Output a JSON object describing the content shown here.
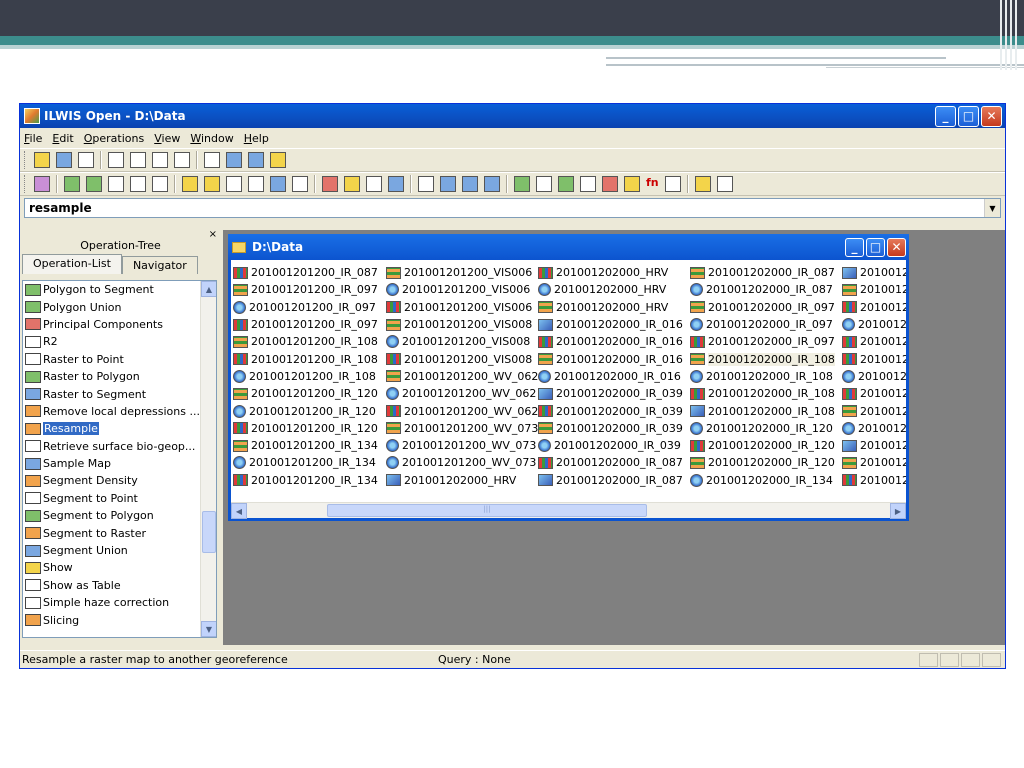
{
  "window": {
    "title": "ILWIS Open - D:\\Data"
  },
  "menu": [
    "File",
    "Edit",
    "Operations",
    "View",
    "Window",
    "Help"
  ],
  "command": {
    "value": "resample"
  },
  "left_pane": {
    "title": "Operation-Tree",
    "tabs": [
      "Operation-List",
      "Navigator"
    ],
    "close_glyph": "×",
    "items": [
      {
        "label": "Polygon to Segment",
        "icon": "polygon-map-icon"
      },
      {
        "label": "Polygon Union",
        "icon": "polygon-map-icon"
      },
      {
        "label": "Principal Components",
        "icon": "matrix-icon"
      },
      {
        "label": "R2",
        "icon": "table-icon"
      },
      {
        "label": "Raster to Point",
        "icon": "point-map-icon"
      },
      {
        "label": "Raster to Polygon",
        "icon": "polygon-map-icon"
      },
      {
        "label": "Raster to Segment",
        "icon": "segment-map-icon"
      },
      {
        "label": "Remove local depressions ...",
        "icon": "raster-map-icon"
      },
      {
        "label": "Resample",
        "icon": "raster-map-icon",
        "selected": true
      },
      {
        "label": "Retrieve surface bio-geop...",
        "icon": "point-map-icon"
      },
      {
        "label": "Sample Map",
        "icon": "sample-set-icon"
      },
      {
        "label": "Segment Density",
        "icon": "raster-map-icon"
      },
      {
        "label": "Segment to Point",
        "icon": "point-map-icon"
      },
      {
        "label": "Segment to Polygon",
        "icon": "polygon-map-icon"
      },
      {
        "label": "Segment to Raster",
        "icon": "raster-map-icon"
      },
      {
        "label": "Segment Union",
        "icon": "segment-map-icon"
      },
      {
        "label": "Show",
        "icon": "show-icon"
      },
      {
        "label": "Show as Table",
        "icon": "table-icon"
      },
      {
        "label": "Simple haze correction",
        "icon": "table-icon"
      },
      {
        "label": "Slicing",
        "icon": "raster-map-icon"
      }
    ]
  },
  "catalog": {
    "title": "D:\\Data",
    "columns": [
      [
        {
          "name": "201001201200_IR_087",
          "type": "raster"
        },
        {
          "name": "201001201200_IR_097",
          "type": "grid"
        },
        {
          "name": "201001201200_IR_097",
          "type": "csy"
        },
        {
          "name": "201001201200_IR_097",
          "type": "raster"
        },
        {
          "name": "201001201200_IR_108",
          "type": "grid"
        },
        {
          "name": "201001201200_IR_108",
          "type": "raster"
        },
        {
          "name": "201001201200_IR_108",
          "type": "csy"
        },
        {
          "name": "201001201200_IR_120",
          "type": "grid"
        },
        {
          "name": "201001201200_IR_120",
          "type": "csy"
        },
        {
          "name": "201001201200_IR_120",
          "type": "raster"
        },
        {
          "name": "201001201200_IR_134",
          "type": "grid"
        },
        {
          "name": "201001201200_IR_134",
          "type": "csy"
        },
        {
          "name": "201001201200_IR_134",
          "type": "raster"
        }
      ],
      [
        {
          "name": "201001201200_VIS006",
          "type": "grid"
        },
        {
          "name": "201001201200_VIS006",
          "type": "csy"
        },
        {
          "name": "201001201200_VIS006",
          "type": "raster"
        },
        {
          "name": "201001201200_VIS008",
          "type": "grid"
        },
        {
          "name": "201001201200_VIS008",
          "type": "csy"
        },
        {
          "name": "201001201200_VIS008",
          "type": "raster"
        },
        {
          "name": "201001201200_WV_062",
          "type": "grid"
        },
        {
          "name": "201001201200_WV_062",
          "type": "csy"
        },
        {
          "name": "201001201200_WV_062",
          "type": "raster"
        },
        {
          "name": "201001201200_WV_073",
          "type": "grid"
        },
        {
          "name": "201001201200_WV_073",
          "type": "csy"
        },
        {
          "name": "201001201200_WV_073",
          "type": "csy"
        },
        {
          "name": "201001202000_HRV",
          "type": "georef"
        }
      ],
      [
        {
          "name": "201001202000_HRV",
          "type": "raster"
        },
        {
          "name": "201001202000_HRV",
          "type": "csy"
        },
        {
          "name": "201001202000_HRV",
          "type": "grid"
        },
        {
          "name": "201001202000_IR_016",
          "type": "georef"
        },
        {
          "name": "201001202000_IR_016",
          "type": "raster"
        },
        {
          "name": "201001202000_IR_016",
          "type": "grid"
        },
        {
          "name": "201001202000_IR_016",
          "type": "csy"
        },
        {
          "name": "201001202000_IR_039",
          "type": "georef"
        },
        {
          "name": "201001202000_IR_039",
          "type": "raster"
        },
        {
          "name": "201001202000_IR_039",
          "type": "grid"
        },
        {
          "name": "201001202000_IR_039",
          "type": "csy"
        },
        {
          "name": "201001202000_IR_087",
          "type": "raster"
        },
        {
          "name": "201001202000_IR_087",
          "type": "georef"
        }
      ],
      [
        {
          "name": "201001202000_IR_087",
          "type": "grid"
        },
        {
          "name": "201001202000_IR_087",
          "type": "csy"
        },
        {
          "name": "201001202000_IR_097",
          "type": "grid"
        },
        {
          "name": "201001202000_IR_097",
          "type": "csy"
        },
        {
          "name": "201001202000_IR_097",
          "type": "raster"
        },
        {
          "name": "201001202000_IR_108",
          "type": "grid",
          "highlighted": true
        },
        {
          "name": "201001202000_IR_108",
          "type": "csy"
        },
        {
          "name": "201001202000_IR_108",
          "type": "raster"
        },
        {
          "name": "201001202000_IR_108",
          "type": "georef"
        },
        {
          "name": "201001202000_IR_120",
          "type": "csy"
        },
        {
          "name": "201001202000_IR_120",
          "type": "raster"
        },
        {
          "name": "201001202000_IR_120",
          "type": "grid"
        },
        {
          "name": "201001202000_IR_134",
          "type": "csy"
        }
      ],
      [
        {
          "name": "2010012",
          "type": "georef"
        },
        {
          "name": "2010012",
          "type": "grid"
        },
        {
          "name": "2010012",
          "type": "raster"
        },
        {
          "name": "2010012",
          "type": "csy"
        },
        {
          "name": "2010012",
          "type": "raster"
        },
        {
          "name": "2010012",
          "type": "raster"
        },
        {
          "name": "2010012",
          "type": "csy"
        },
        {
          "name": "2010012",
          "type": "raster"
        },
        {
          "name": "2010012",
          "type": "grid"
        },
        {
          "name": "2010012",
          "type": "csy"
        },
        {
          "name": "2010012",
          "type": "georef"
        },
        {
          "name": "2010012",
          "type": "grid"
        },
        {
          "name": "2010012",
          "type": "raster"
        }
      ]
    ]
  },
  "status": {
    "hint": "Resample a raster map to another georeference",
    "query": "Query : None"
  },
  "colors": {
    "title_blue": "#0a5fd8",
    "selection": "#316ac5",
    "mdi_bg": "#808080"
  }
}
